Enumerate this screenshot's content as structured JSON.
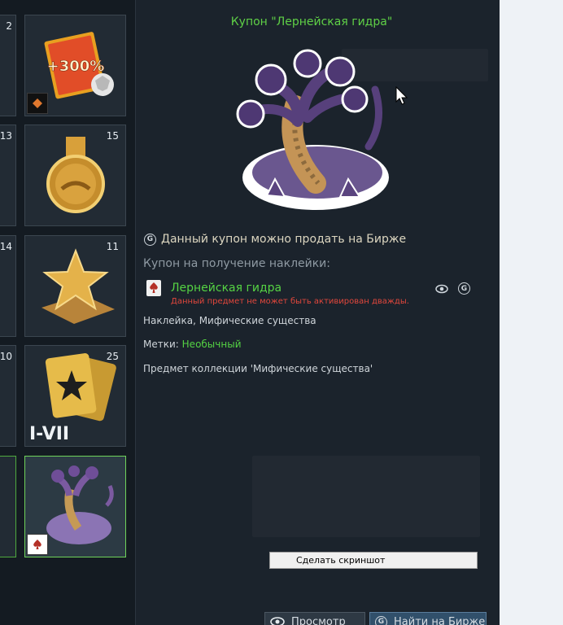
{
  "grid": {
    "left_counts": [
      "2",
      "13",
      "14",
      "10"
    ],
    "cells": [
      {
        "count": "",
        "image_text": "+300%",
        "badge": "diamond-badge-icon"
      },
      {
        "count": "15",
        "image_text": "",
        "badge": ""
      },
      {
        "count": "11",
        "image_text": "",
        "badge": ""
      },
      {
        "count": "25",
        "image_text": "I-VII",
        "badge": ""
      },
      {
        "count": "",
        "image_text": "",
        "badge": "ace-spade-icon"
      }
    ]
  },
  "details": {
    "title": "Купон \"Лернейская гидра\"",
    "sell_text": "Данный купон можно продать на Бирже",
    "coupon_label": "Купон на получение наклейки:",
    "sticker_name": "Лернейская гидра",
    "sticker_warning": "Данный предмет не может быть активирован дважды.",
    "sticker_type": "Наклейка, Мифические существа",
    "tags_label": "Метки:",
    "tags_value": "Необычный",
    "collection": "Предмет коллекции 'Мифические существа'"
  },
  "context_menu": {
    "item": "Сделать скриншот"
  },
  "buttons": {
    "view": "Просмотр",
    "find": "Найти на Бирже"
  },
  "colors": {
    "green": "#55d343",
    "warning_red": "#e2473c",
    "selected_border": "#6fd35a"
  }
}
